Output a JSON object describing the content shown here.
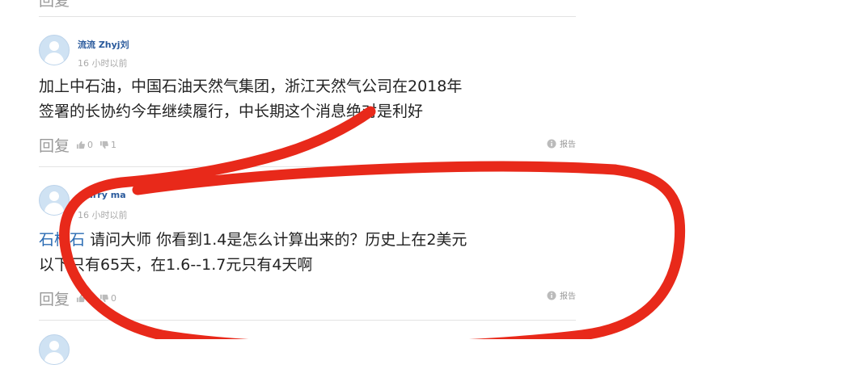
{
  "top_comment": {
    "reply_label": "回复"
  },
  "comments": [
    {
      "username": "流流 Zhyj刘",
      "time": "16 小时以前",
      "lines": [
        "加上中石油，中国石油天然气集团，浙江天然气公司在2018年",
        "签署的长协约今年继续履行，中长期这个消息绝对是利好"
      ],
      "reply_label": "回复",
      "likes": "0",
      "dislikes": "1",
      "report_label": "报告"
    },
    {
      "username": "marry ma",
      "time": "16 小时以前",
      "mention": "石杨石",
      "lines": [
        "请问大师 你看到1.4是怎么计算出来的？历史上在2美元",
        "以下只有65天，在1.6--1.7元只有4天啊"
      ],
      "reply_label": "回复",
      "likes": "0",
      "dislikes": "0",
      "report_label": "报告"
    }
  ],
  "annotation": {
    "color": "#e8291a"
  }
}
